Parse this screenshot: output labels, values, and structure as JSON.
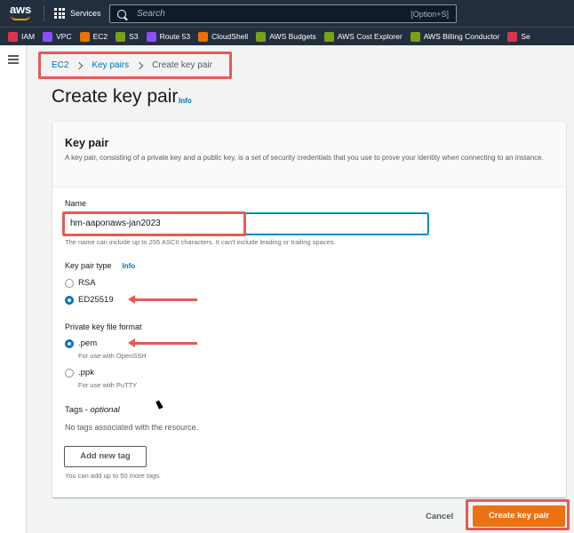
{
  "topbar": {
    "logo_text": "aws",
    "services_label": "Services",
    "search_placeholder": "Search",
    "search_shortcut": "[Option+S]"
  },
  "favorites": [
    {
      "label": "IAM",
      "color": "#dd344c"
    },
    {
      "label": "VPC",
      "color": "#8c4fff"
    },
    {
      "label": "EC2",
      "color": "#ed7100"
    },
    {
      "label": "S3",
      "color": "#7aa116"
    },
    {
      "label": "Route 53",
      "color": "#8c4fff"
    },
    {
      "label": "CloudShell",
      "color": "#ed7100"
    },
    {
      "label": "AWS Budgets",
      "color": "#7aa116"
    },
    {
      "label": "AWS Cost Explorer",
      "color": "#7aa116"
    },
    {
      "label": "AWS Billing Conductor",
      "color": "#7aa116"
    },
    {
      "label": "Se",
      "color": "#dd344c"
    }
  ],
  "breadcrumb": {
    "items": [
      "EC2",
      "Key pairs"
    ],
    "current": "Create key pair"
  },
  "page": {
    "title": "Create key pair",
    "info": "Info"
  },
  "card": {
    "heading": "Key pair",
    "description": "A key pair, consisting of a private key and a public key, is a set of security credentials that you use to prove your identity when connecting to an instance."
  },
  "form": {
    "name_label": "Name",
    "name_value": "hm-aaponaws-jan2023",
    "name_hint": "The name can include up to 255 ASCII characters. It can't include leading or trailing spaces.",
    "key_type_label": "Key pair type",
    "key_type_info": "Info",
    "key_types": [
      {
        "label": "RSA",
        "selected": false
      },
      {
        "label": "ED25519",
        "selected": true
      }
    ],
    "format_label": "Private key file format",
    "formats": [
      {
        "label": ".pem",
        "hint": "For use with OpenSSH",
        "selected": true
      },
      {
        "label": ".ppk",
        "hint": "For use with PuTTY",
        "selected": false
      }
    ],
    "tags_title": "Tags - ",
    "tags_optional": "optional",
    "tags_empty": "No tags associated with the resource.",
    "add_tag_label": "Add new tag",
    "tags_hint": "You can add up to 50 more tags."
  },
  "actions": {
    "cancel_label": "Cancel",
    "create_label": "Create key pair"
  },
  "colors": {
    "primary_button": "#ec7211",
    "link": "#0073bb",
    "highlight": "#e65a57",
    "topbar": "#232f3e"
  }
}
